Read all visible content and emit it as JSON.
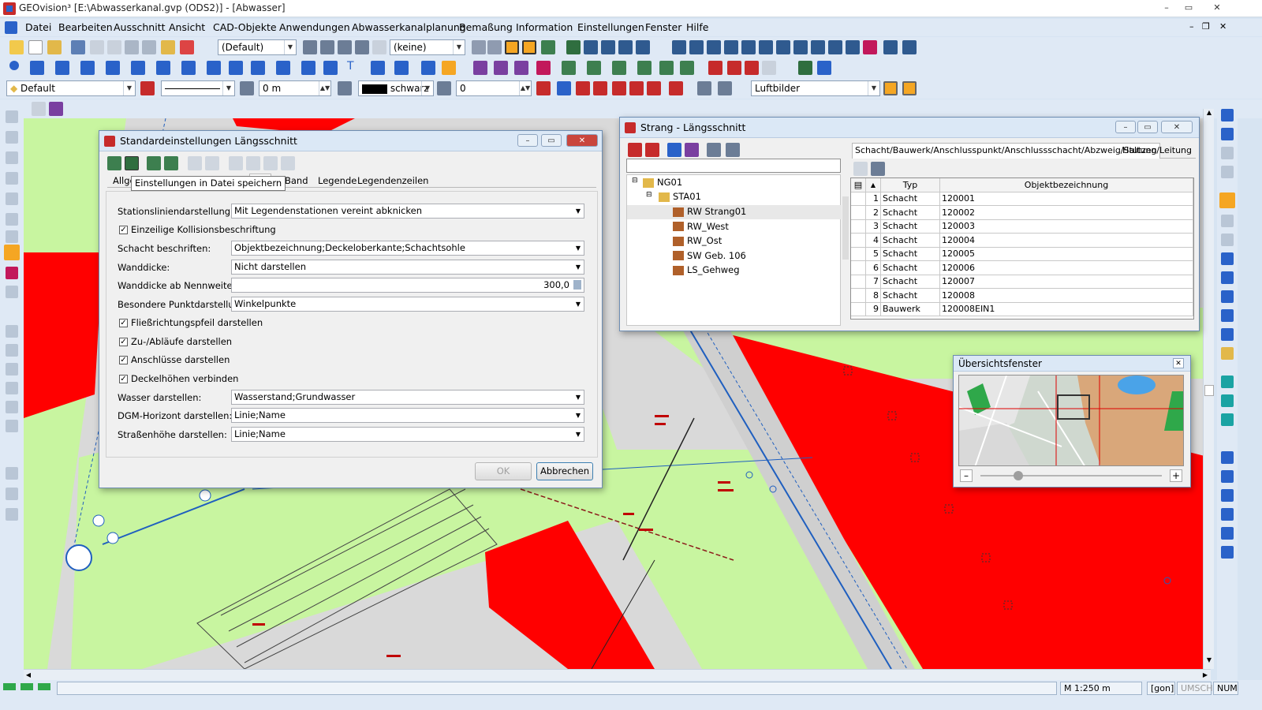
{
  "titlebar": {
    "title": "GEOvision³  [E:\\Abwasserkanal.gvp (ODS2)] - [Abwasser]",
    "min": "–",
    "max": "▭",
    "close": "✕"
  },
  "menu": [
    "Datei",
    "Bearbeiten",
    "Ausschnitt",
    "Ansicht",
    "CAD-Objekte",
    "Anwendungen",
    "Abwasserkanalplanung",
    "Bemaßung",
    "Information",
    "Einstellungen",
    "Fenster",
    "Hilfe"
  ],
  "toolbar": {
    "view_combo": "(Default)",
    "filter_combo": "(keine)",
    "layer_combo": "Default",
    "distance": "0 m",
    "color_name": "schwarz",
    "angle": "0",
    "background_combo": "Luftbilder"
  },
  "dialog_std": {
    "title": "Standardeinstellungen Längsschnitt",
    "tooltip": "Einstellungen in Datei speichern",
    "tabs": [
      "Allge",
      "nitt",
      "Band",
      "Legende",
      "Legendenzeilen"
    ],
    "rows": {
      "station_label": "Stationsliniendarstellung:",
      "station_value": "Mit Legendenstationen vereint abknicken",
      "collision_label": "Einzeilige Kollisionsbeschriftung",
      "schacht_label": "Schacht beschriften:",
      "schacht_value": "Objektbezeichnung;Deckeloberkante;Schachtsohle",
      "wand_label": "Wanddicke:",
      "wand_value": "Nicht darstellen",
      "wandnw_label": "Wanddicke ab Nennweite:",
      "wandnw_value": "300,0",
      "punkt_label": "Besondere Punktdarstellung:",
      "punkt_value": "Winkelpunkte",
      "fliess_label": "Fließrichtungspfeil darstellen",
      "zuab_label": "Zu-/Abläufe darstellen",
      "anschl_label": "Anschlüsse darstellen",
      "deckel_label": "Deckelhöhen verbinden",
      "wasser_label": "Wasser darstellen:",
      "wasser_value": "Wasserstand;Grundwasser",
      "dgm_label": "DGM-Horizont darstellen:",
      "dgm_value": "Linie;Name",
      "strasse_label": "Straßenhöhe darstellen:",
      "strasse_value": "Linie;Name"
    },
    "ok": "OK",
    "cancel": "Abbrechen"
  },
  "dialog_strang": {
    "title": "Strang - Längsschnitt",
    "tabs": [
      "Schacht/Bauwerk/Anschlusspunkt/Anschlussschacht/Abzweig/Stutzen",
      "Haltung/Leitung"
    ],
    "tree": {
      "root": "NG01",
      "sta": "STA01",
      "items": [
        "RW Strang01",
        "RW_West",
        "RW_Ost",
        "SW Geb. 106",
        "LS_Gehweg"
      ]
    },
    "table": {
      "headers": [
        "Typ",
        "Objektbezeichnung"
      ],
      "rows": [
        {
          "n": "1",
          "typ": "Schacht",
          "obj": "120001"
        },
        {
          "n": "2",
          "typ": "Schacht",
          "obj": "120002"
        },
        {
          "n": "3",
          "typ": "Schacht",
          "obj": "120003"
        },
        {
          "n": "4",
          "typ": "Schacht",
          "obj": "120004"
        },
        {
          "n": "5",
          "typ": "Schacht",
          "obj": "120005"
        },
        {
          "n": "6",
          "typ": "Schacht",
          "obj": "120006"
        },
        {
          "n": "7",
          "typ": "Schacht",
          "obj": "120007"
        },
        {
          "n": "8",
          "typ": "Schacht",
          "obj": "120008"
        },
        {
          "n": "9",
          "typ": "Bauwerk",
          "obj": "120008EIN1"
        }
      ]
    }
  },
  "overview": {
    "title": "Übersichtsfenster",
    "minus": "–",
    "plus": "+"
  },
  "status": {
    "scale": "M 1:250  m",
    "unit": "[gon]",
    "shift": "UMSCH",
    "num": "NUM"
  },
  "colors": {
    "red_area": "#ff0000",
    "green_area": "#c8f5a0",
    "grey_area": "#d9d9d9",
    "accent": "#1f5fbf"
  }
}
